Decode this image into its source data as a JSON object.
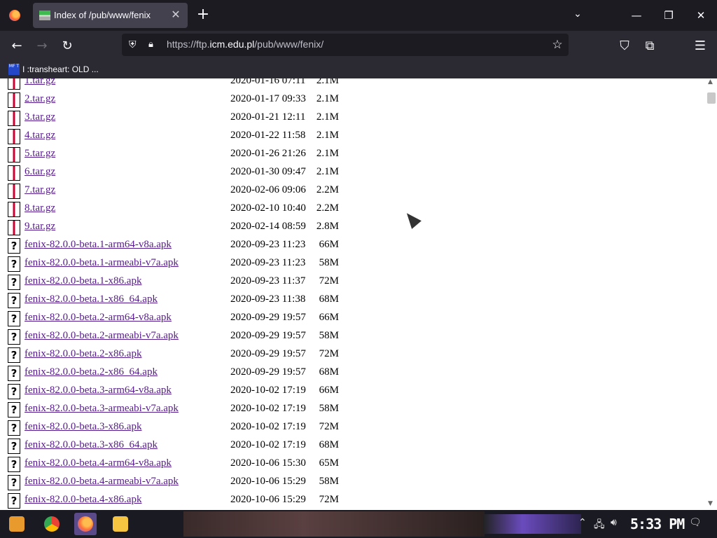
{
  "browser": {
    "tab": {
      "title": "Index of /pub/www/fenix",
      "close": "✕"
    },
    "new_tab": "+",
    "list_tabs": "⌄",
    "window": {
      "minimize": "—",
      "restore": "❐",
      "close": "✕"
    },
    "nav": {
      "back": "←",
      "forward": "→",
      "reload": "↻"
    },
    "url": {
      "prefix": "https://ftp.",
      "domain": "icm.edu.pl",
      "path": "/pub/www/fenix/"
    },
    "bookmark_star": "☆",
    "toolbar_icons": {
      "pocket": "⛉",
      "extensions": "⧉",
      "menu": "☰"
    },
    "bookmark": {
      "label": "I :transheart: OLD ...",
      "icon_text": "MF T"
    }
  },
  "files": [
    {
      "name": "1.tar.gz",
      "date": "2020-01-16 07:11",
      "size": "2.1M",
      "type": "gz"
    },
    {
      "name": "2.tar.gz",
      "date": "2020-01-17 09:33",
      "size": "2.1M",
      "type": "gz"
    },
    {
      "name": "3.tar.gz",
      "date": "2020-01-21 12:11",
      "size": "2.1M",
      "type": "gz"
    },
    {
      "name": "4.tar.gz",
      "date": "2020-01-22 11:58",
      "size": "2.1M",
      "type": "gz"
    },
    {
      "name": "5.tar.gz",
      "date": "2020-01-26 21:26",
      "size": "2.1M",
      "type": "gz"
    },
    {
      "name": "6.tar.gz",
      "date": "2020-01-30 09:47",
      "size": "2.1M",
      "type": "gz"
    },
    {
      "name": "7.tar.gz",
      "date": "2020-02-06 09:06",
      "size": "2.2M",
      "type": "gz"
    },
    {
      "name": "8.tar.gz",
      "date": "2020-02-10 10:40",
      "size": "2.2M",
      "type": "gz"
    },
    {
      "name": "9.tar.gz",
      "date": "2020-02-14 08:59",
      "size": "2.8M",
      "type": "gz"
    },
    {
      "name": "fenix-82.0.0-beta.1-arm64-v8a.apk",
      "date": "2020-09-23 11:23",
      "size": "66M",
      "type": "unknown"
    },
    {
      "name": "fenix-82.0.0-beta.1-armeabi-v7a.apk",
      "date": "2020-09-23 11:23",
      "size": "58M",
      "type": "unknown"
    },
    {
      "name": "fenix-82.0.0-beta.1-x86.apk",
      "date": "2020-09-23 11:37",
      "size": "72M",
      "type": "unknown"
    },
    {
      "name": "fenix-82.0.0-beta.1-x86_64.apk",
      "date": "2020-09-23 11:38",
      "size": "68M",
      "type": "unknown"
    },
    {
      "name": "fenix-82.0.0-beta.2-arm64-v8a.apk",
      "date": "2020-09-29 19:57",
      "size": "66M",
      "type": "unknown"
    },
    {
      "name": "fenix-82.0.0-beta.2-armeabi-v7a.apk",
      "date": "2020-09-29 19:57",
      "size": "58M",
      "type": "unknown"
    },
    {
      "name": "fenix-82.0.0-beta.2-x86.apk",
      "date": "2020-09-29 19:57",
      "size": "72M",
      "type": "unknown"
    },
    {
      "name": "fenix-82.0.0-beta.2-x86_64.apk",
      "date": "2020-09-29 19:57",
      "size": "68M",
      "type": "unknown"
    },
    {
      "name": "fenix-82.0.0-beta.3-arm64-v8a.apk",
      "date": "2020-10-02 17:19",
      "size": "66M",
      "type": "unknown"
    },
    {
      "name": "fenix-82.0.0-beta.3-armeabi-v7a.apk",
      "date": "2020-10-02 17:19",
      "size": "58M",
      "type": "unknown"
    },
    {
      "name": "fenix-82.0.0-beta.3-x86.apk",
      "date": "2020-10-02 17:19",
      "size": "72M",
      "type": "unknown"
    },
    {
      "name": "fenix-82.0.0-beta.3-x86_64.apk",
      "date": "2020-10-02 17:19",
      "size": "68M",
      "type": "unknown"
    },
    {
      "name": "fenix-82.0.0-beta.4-arm64-v8a.apk",
      "date": "2020-10-06 15:30",
      "size": "65M",
      "type": "unknown"
    },
    {
      "name": "fenix-82.0.0-beta.4-armeabi-v7a.apk",
      "date": "2020-10-06 15:29",
      "size": "58M",
      "type": "unknown"
    },
    {
      "name": "fenix-82.0.0-beta.4-x86.apk",
      "date": "2020-10-06 15:29",
      "size": "72M",
      "type": "unknown"
    }
  ],
  "taskbar": {
    "clock": "5:33 PM",
    "tray_icons": [
      "chevron-up-icon",
      "network-icon",
      "volume-icon"
    ],
    "apps": [
      "start-icon",
      "chrome-icon",
      "firefox-icon",
      "file-explorer-icon"
    ],
    "colors": {
      "chrome": "#34a853",
      "firefox": "#ff7139",
      "explorer": "#f5c542",
      "start": "#e89a2c"
    }
  }
}
